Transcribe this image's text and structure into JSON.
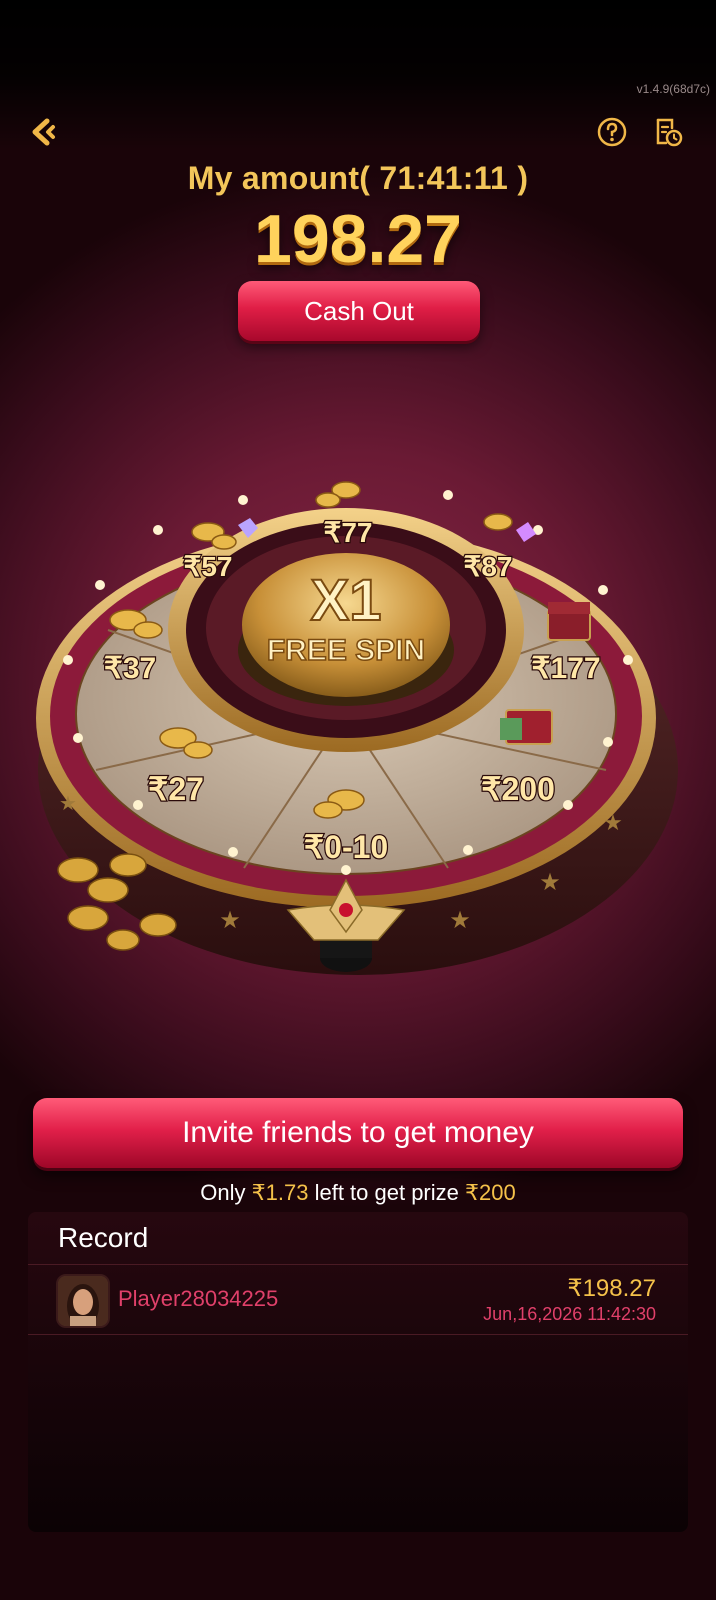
{
  "app": {
    "version": "v1.4.9(68d7c)"
  },
  "header": {
    "amount_label": "My amount(   71:41:11   )",
    "amount_value": "198.27",
    "cashout_label": "Cash Out"
  },
  "wheel": {
    "center_multiplier": "X1",
    "center_text": "FREE SPIN",
    "prizes": [
      "₹77",
      "₹87",
      "₹177",
      "₹200",
      "₹0-10",
      "₹27",
      "₹37",
      "₹57"
    ]
  },
  "invite": {
    "button_label": "Invite friends to get money",
    "progress_prefix": "Only ",
    "progress_remaining": "₹1.73",
    "progress_middle": " left to get prize ",
    "progress_target": "₹200"
  },
  "record": {
    "title": "Record",
    "entries": [
      {
        "player": "Player28034225",
        "amount": "₹198.27",
        "time": "Jun,16,2026 11:42:30"
      }
    ]
  },
  "colors": {
    "gold": "#f5c24a",
    "accent_red": "#e2204a",
    "player_pink": "#e0406a",
    "background": "#6a1a34"
  },
  "icons": [
    "back-arrow-icon",
    "help-icon",
    "history-icon",
    "coin-stack-icon",
    "gem-icon",
    "treasure-chest-icon",
    "pointer-icon"
  ]
}
